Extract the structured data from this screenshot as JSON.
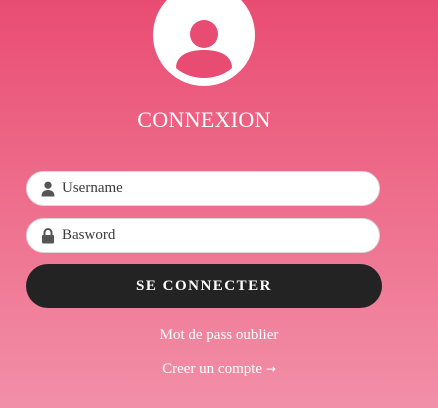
{
  "login": {
    "title": "CONNEXION",
    "username_placeholder": "Username",
    "password_placeholder": "Basword",
    "submit_label": "SE CONNECTER",
    "forgot_label": "Mot de pass oublier",
    "register_label": "Creer un compte",
    "register_arrow": "→"
  },
  "icons": {
    "avatar": "user-avatar-icon",
    "username": "user-icon",
    "password": "lock-icon"
  },
  "colors": {
    "gradient_top": "#e94c72",
    "gradient_bottom": "#f28fa8",
    "button": "#232323",
    "avatar_glyph": "#e94c72"
  }
}
